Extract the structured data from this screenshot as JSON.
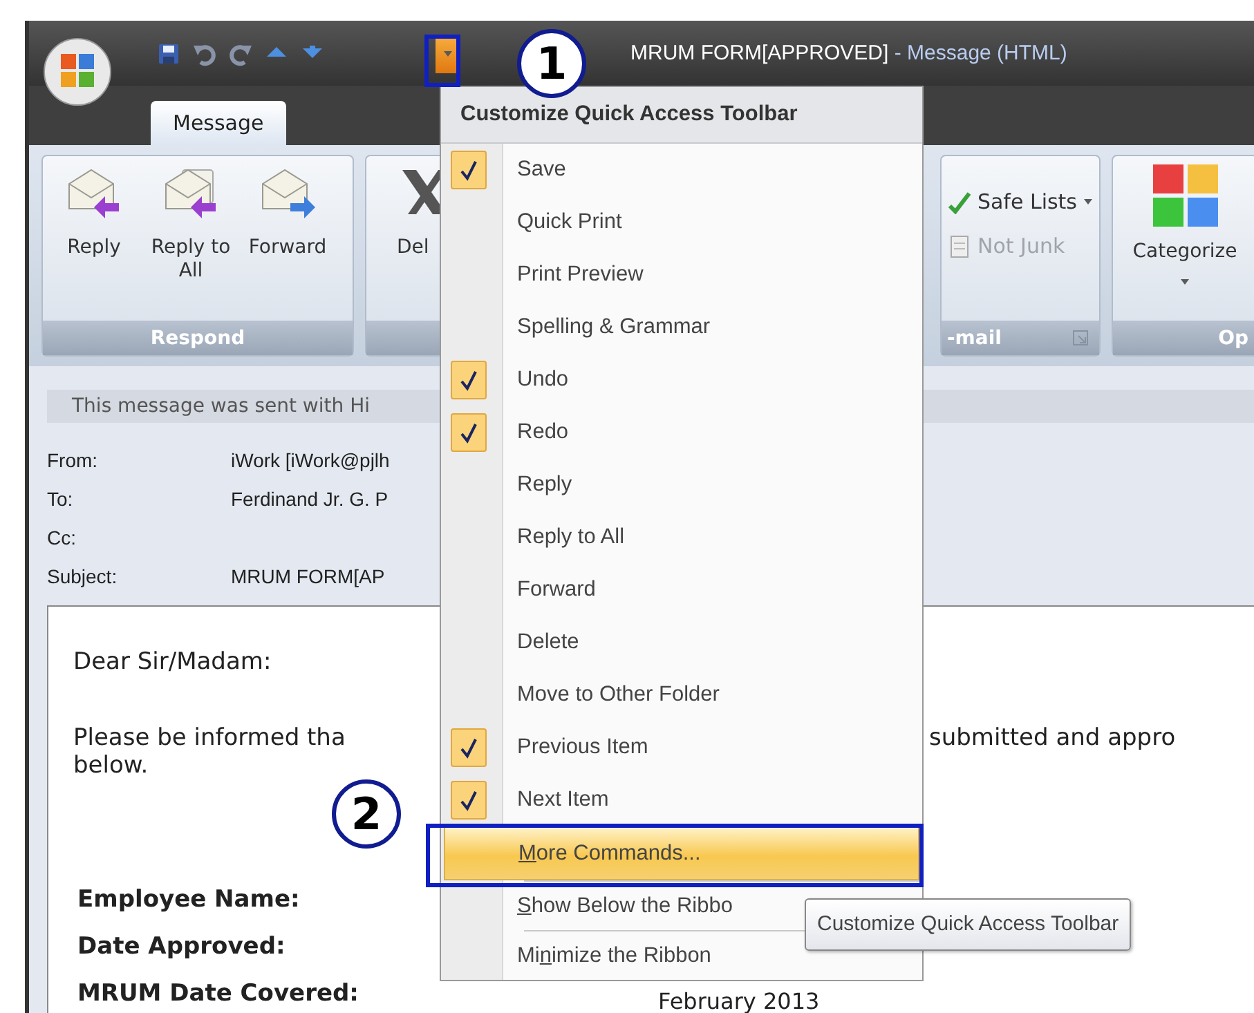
{
  "window": {
    "title": "MRUM FORM[APPROVED]",
    "title_suffix": " - Message (HTML)"
  },
  "quick_access": {
    "items": [
      {
        "kind": "save"
      },
      {
        "kind": "undo"
      },
      {
        "kind": "redo"
      },
      {
        "kind": "previous"
      },
      {
        "kind": "next"
      }
    ],
    "menu_open": true
  },
  "tabs": [
    {
      "label": "Message",
      "selected": true
    }
  ],
  "ribbon": {
    "groups": [
      {
        "kind": "large",
        "label": "Respond",
        "buttons": [
          {
            "label": "Reply",
            "kind": "reply"
          },
          {
            "label": "Reply to All",
            "kind": "reply-all"
          },
          {
            "label": "Forward",
            "kind": "forward"
          }
        ]
      },
      {
        "kind": "large",
        "buttons": [
          {
            "label": "Del",
            "kind": "delete"
          }
        ]
      },
      {
        "kind": "small",
        "label": "-mail",
        "buttons": [
          {
            "label": "Safe Lists",
            "kind": "safe",
            "disabled": false
          },
          {
            "label": "Not Junk",
            "kind": "notjunk",
            "disabled": true
          }
        ]
      },
      {
        "kind": "large",
        "label": "Op",
        "buttons": [
          {
            "label": "Categorize",
            "kind": "categorize"
          }
        ]
      }
    ]
  },
  "message": {
    "infobar": "This message was sent with Hi",
    "fields": [
      {
        "label": "From:",
        "value": "iWork [iWork@pjlh"
      },
      {
        "label": "To:",
        "value": "Ferdinand Jr. G. P"
      },
      {
        "label": "Cc:"
      },
      {
        "label": "Subject:",
        "value": "MRUM FORM[AP"
      }
    ],
    "greeting": "Dear Sir/Madam:",
    "paragraph": {
      "left": "Please be informed tha",
      "right": "submitted and appro",
      "last": "below."
    },
    "details": [
      {
        "label": "Employee Name:"
      },
      {
        "label": "Date Approved:"
      },
      {
        "label": "MRUM Date Covered:",
        "value": "February 2013"
      }
    ]
  },
  "menu": {
    "title": "Customize Quick Access Toolbar",
    "commands": [
      {
        "label": "Save",
        "checked": true
      },
      {
        "label": "Quick Print",
        "checked": false
      },
      {
        "label": "Print Preview",
        "checked": false
      },
      {
        "label": "Spelling & Grammar",
        "checked": false
      },
      {
        "label": "Undo",
        "checked": true
      },
      {
        "label": "Redo",
        "checked": true
      },
      {
        "label": "Reply",
        "checked": false
      },
      {
        "label": "Reply to All",
        "checked": false
      },
      {
        "label": "Forward",
        "checked": false
      },
      {
        "label": "Delete",
        "checked": false
      },
      {
        "label": "Move to Other Folder",
        "checked": false
      },
      {
        "label": "Previous Item",
        "checked": true
      },
      {
        "label": "Next Item",
        "checked": true
      }
    ],
    "options": [
      {
        "key": "M",
        "after": "ore Commands...",
        "selected": true
      },
      {
        "key": "S",
        "after": "how Below the Ribbo",
        "selected": false
      },
      {
        "before": "Mi",
        "key": "n",
        "after": "imize the Ribbon",
        "selected": false
      }
    ]
  },
  "tooltip": "Customize Quick Access Toolbar",
  "callouts": [
    {
      "label": "1"
    },
    {
      "label": "2"
    }
  ]
}
